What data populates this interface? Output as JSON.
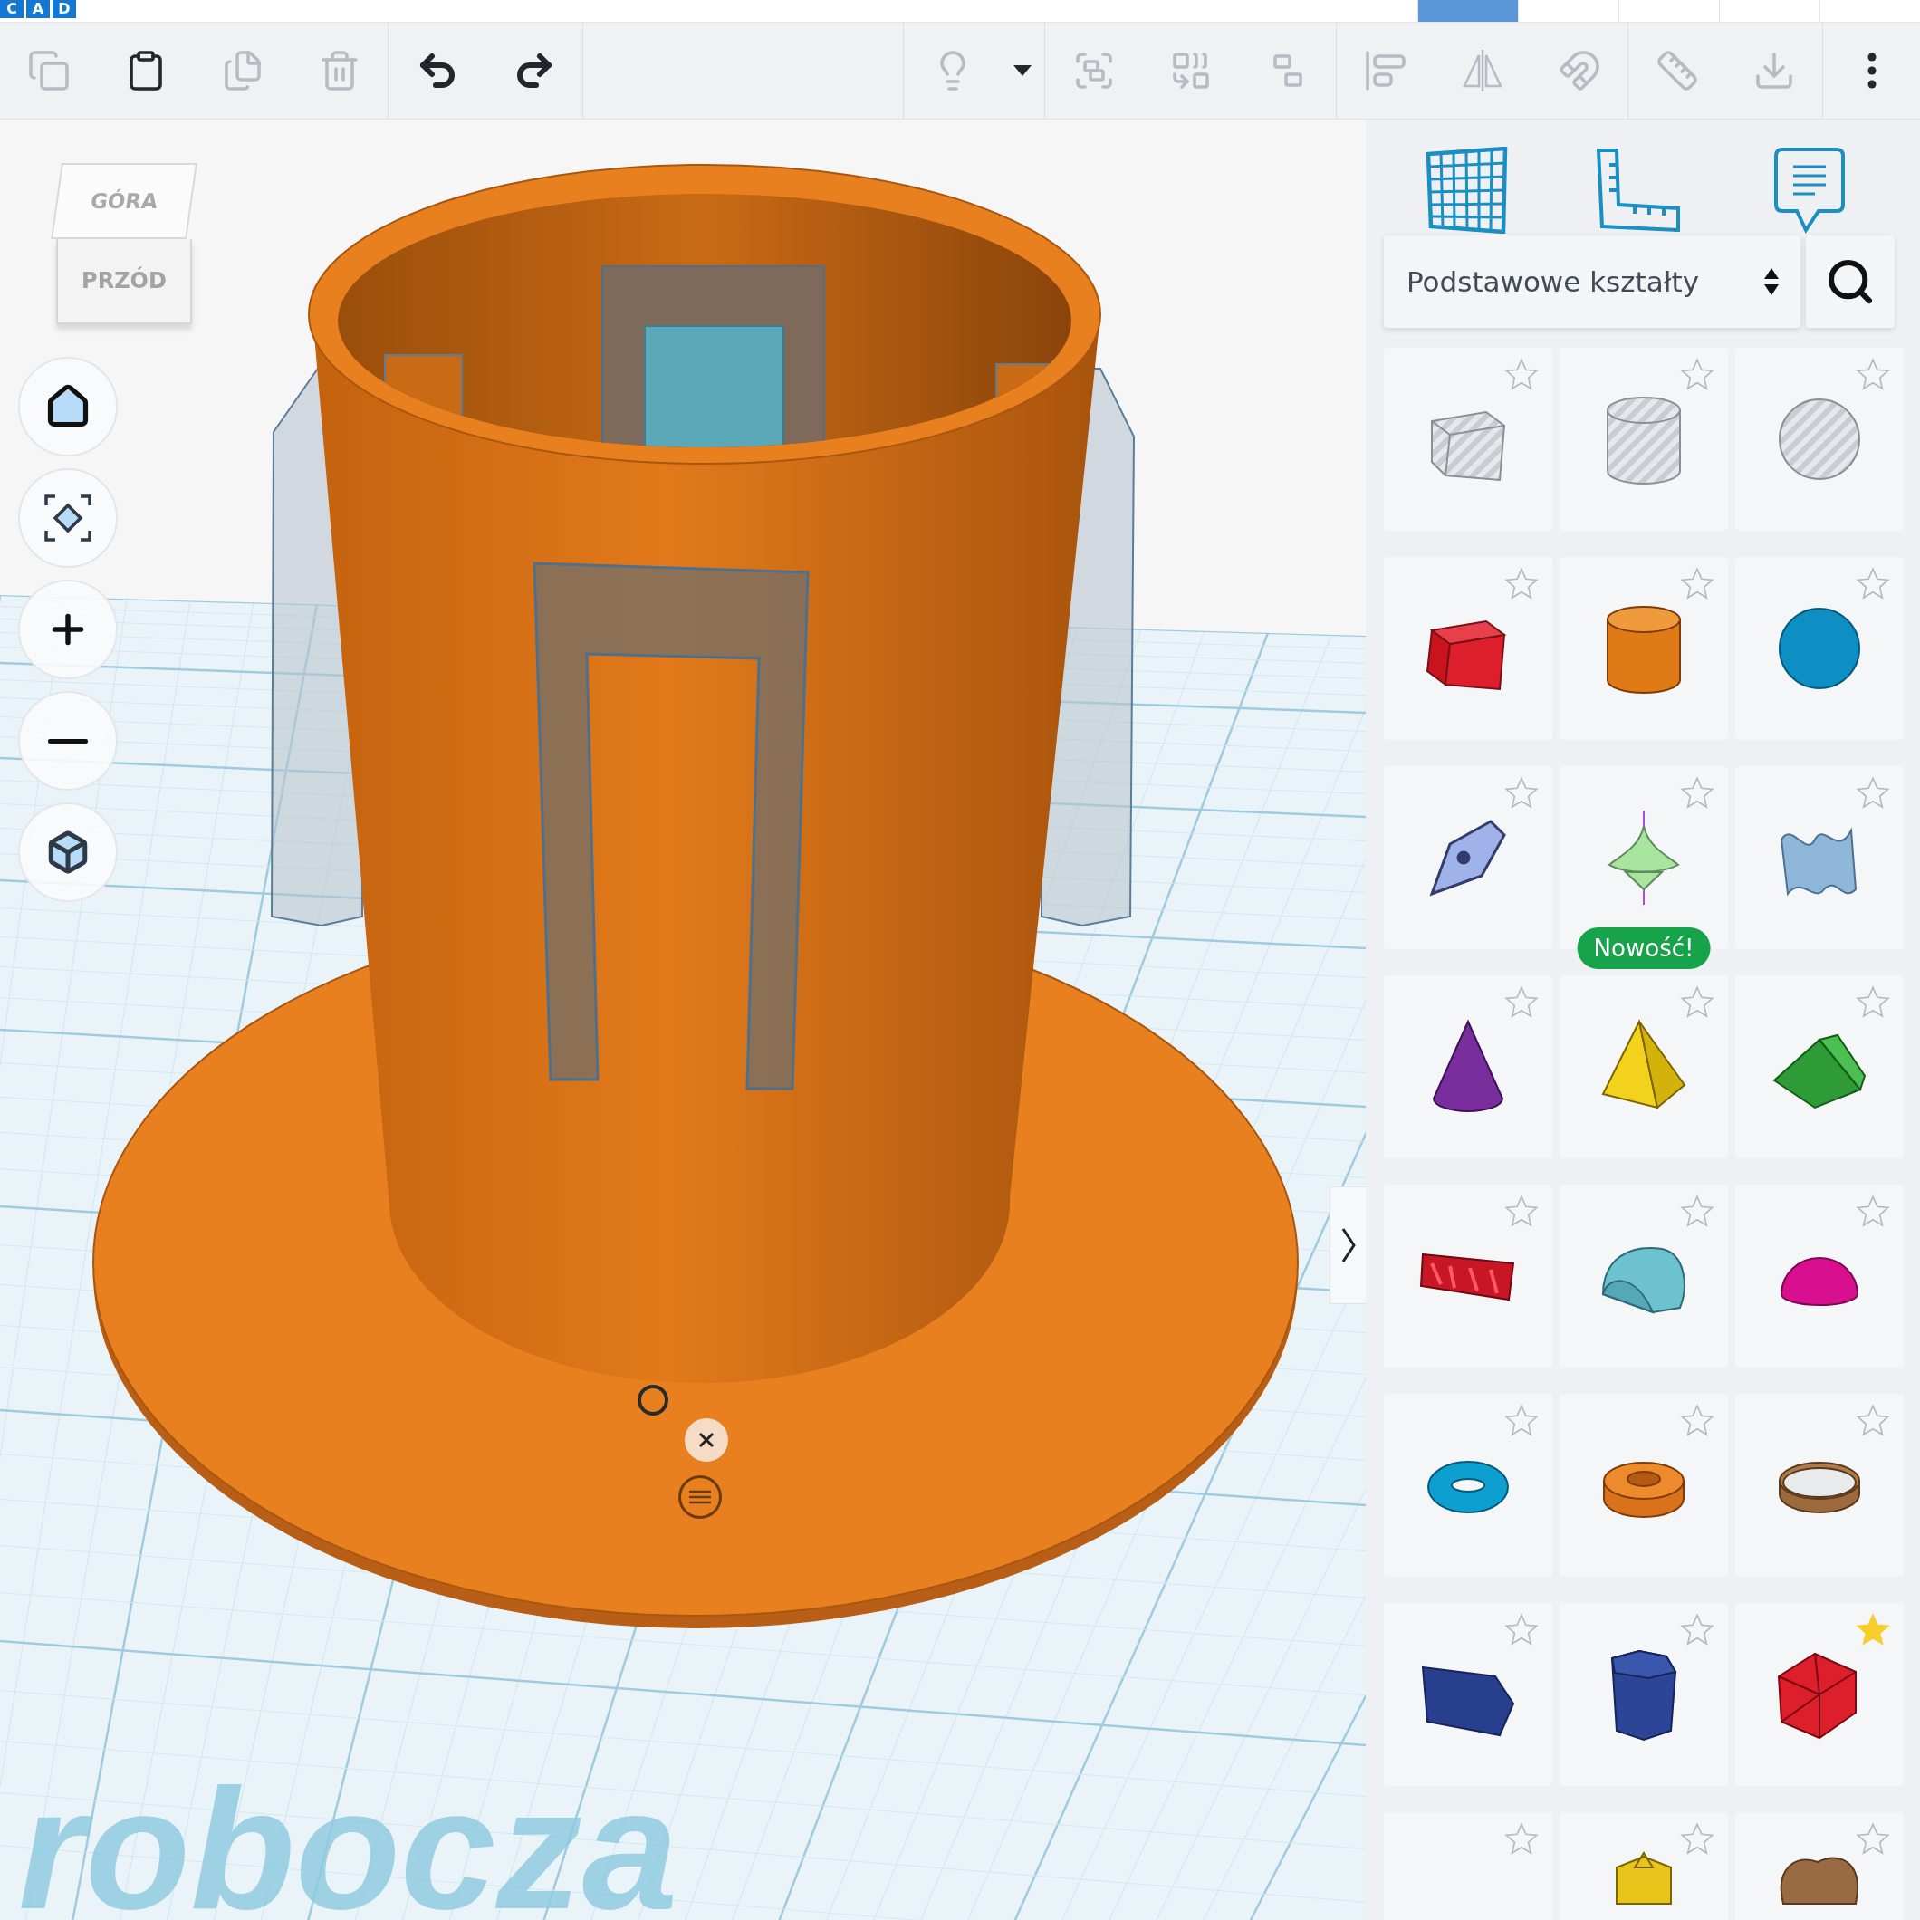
{
  "logo": {
    "letters": [
      "C",
      "A",
      "D"
    ]
  },
  "toolbar": {
    "groups": [
      [
        {
          "kind": "copy",
          "disabled": true
        },
        {
          "kind": "paste",
          "disabled": false
        },
        {
          "kind": "duplicate",
          "disabled": true
        },
        {
          "kind": "delete",
          "disabled": true
        }
      ],
      [
        {
          "kind": "undo",
          "disabled": false
        },
        {
          "kind": "redo",
          "disabled": false
        }
      ],
      [
        {
          "kind": "lightbulb",
          "disabled": true
        },
        {
          "kind": "caret",
          "disabled": false
        }
      ],
      [
        {
          "kind": "group",
          "disabled": true
        },
        {
          "kind": "union",
          "disabled": true
        },
        {
          "kind": "ungroup",
          "disabled": true
        }
      ],
      [
        {
          "kind": "align",
          "disabled": true
        },
        {
          "kind": "mirror",
          "disabled": true
        },
        {
          "kind": "magnet",
          "disabled": true
        }
      ],
      [
        {
          "kind": "ruler",
          "disabled": true
        },
        {
          "kind": "import",
          "disabled": true
        }
      ],
      [
        {
          "kind": "more",
          "disabled": false
        }
      ]
    ]
  },
  "view_cube": {
    "top": "GÓRA",
    "front": "PRZÓD"
  },
  "workplane": {
    "label": "robocza"
  },
  "library": {
    "category": "Podstawowe kształty",
    "shapes": [
      {
        "kind": "box-hole",
        "favorite": false
      },
      {
        "kind": "cylinder-hole",
        "favorite": false
      },
      {
        "kind": "sphere-hole",
        "favorite": false
      },
      {
        "kind": "box",
        "favorite": false
      },
      {
        "kind": "cylinder",
        "favorite": false
      },
      {
        "kind": "sphere",
        "favorite": false
      },
      {
        "kind": "scribble",
        "favorite": false
      },
      {
        "kind": "spinner",
        "favorite": false,
        "badge": "Nowość!"
      },
      {
        "kind": "wave",
        "favorite": false
      },
      {
        "kind": "cone",
        "favorite": false
      },
      {
        "kind": "pyramid",
        "favorite": false
      },
      {
        "kind": "roof",
        "favorite": false
      },
      {
        "kind": "text",
        "favorite": false
      },
      {
        "kind": "half-cylinder",
        "favorite": false
      },
      {
        "kind": "half-sphere",
        "favorite": false
      },
      {
        "kind": "torus",
        "favorite": false
      },
      {
        "kind": "tube",
        "favorite": false
      },
      {
        "kind": "ring",
        "favorite": false
      },
      {
        "kind": "wedge",
        "favorite": false
      },
      {
        "kind": "prism",
        "favorite": false
      },
      {
        "kind": "icosahedron",
        "favorite": true
      },
      {
        "kind": "blank",
        "favorite": false
      },
      {
        "kind": "star",
        "favorite": false
      },
      {
        "kind": "heart",
        "favorite": false
      }
    ]
  }
}
